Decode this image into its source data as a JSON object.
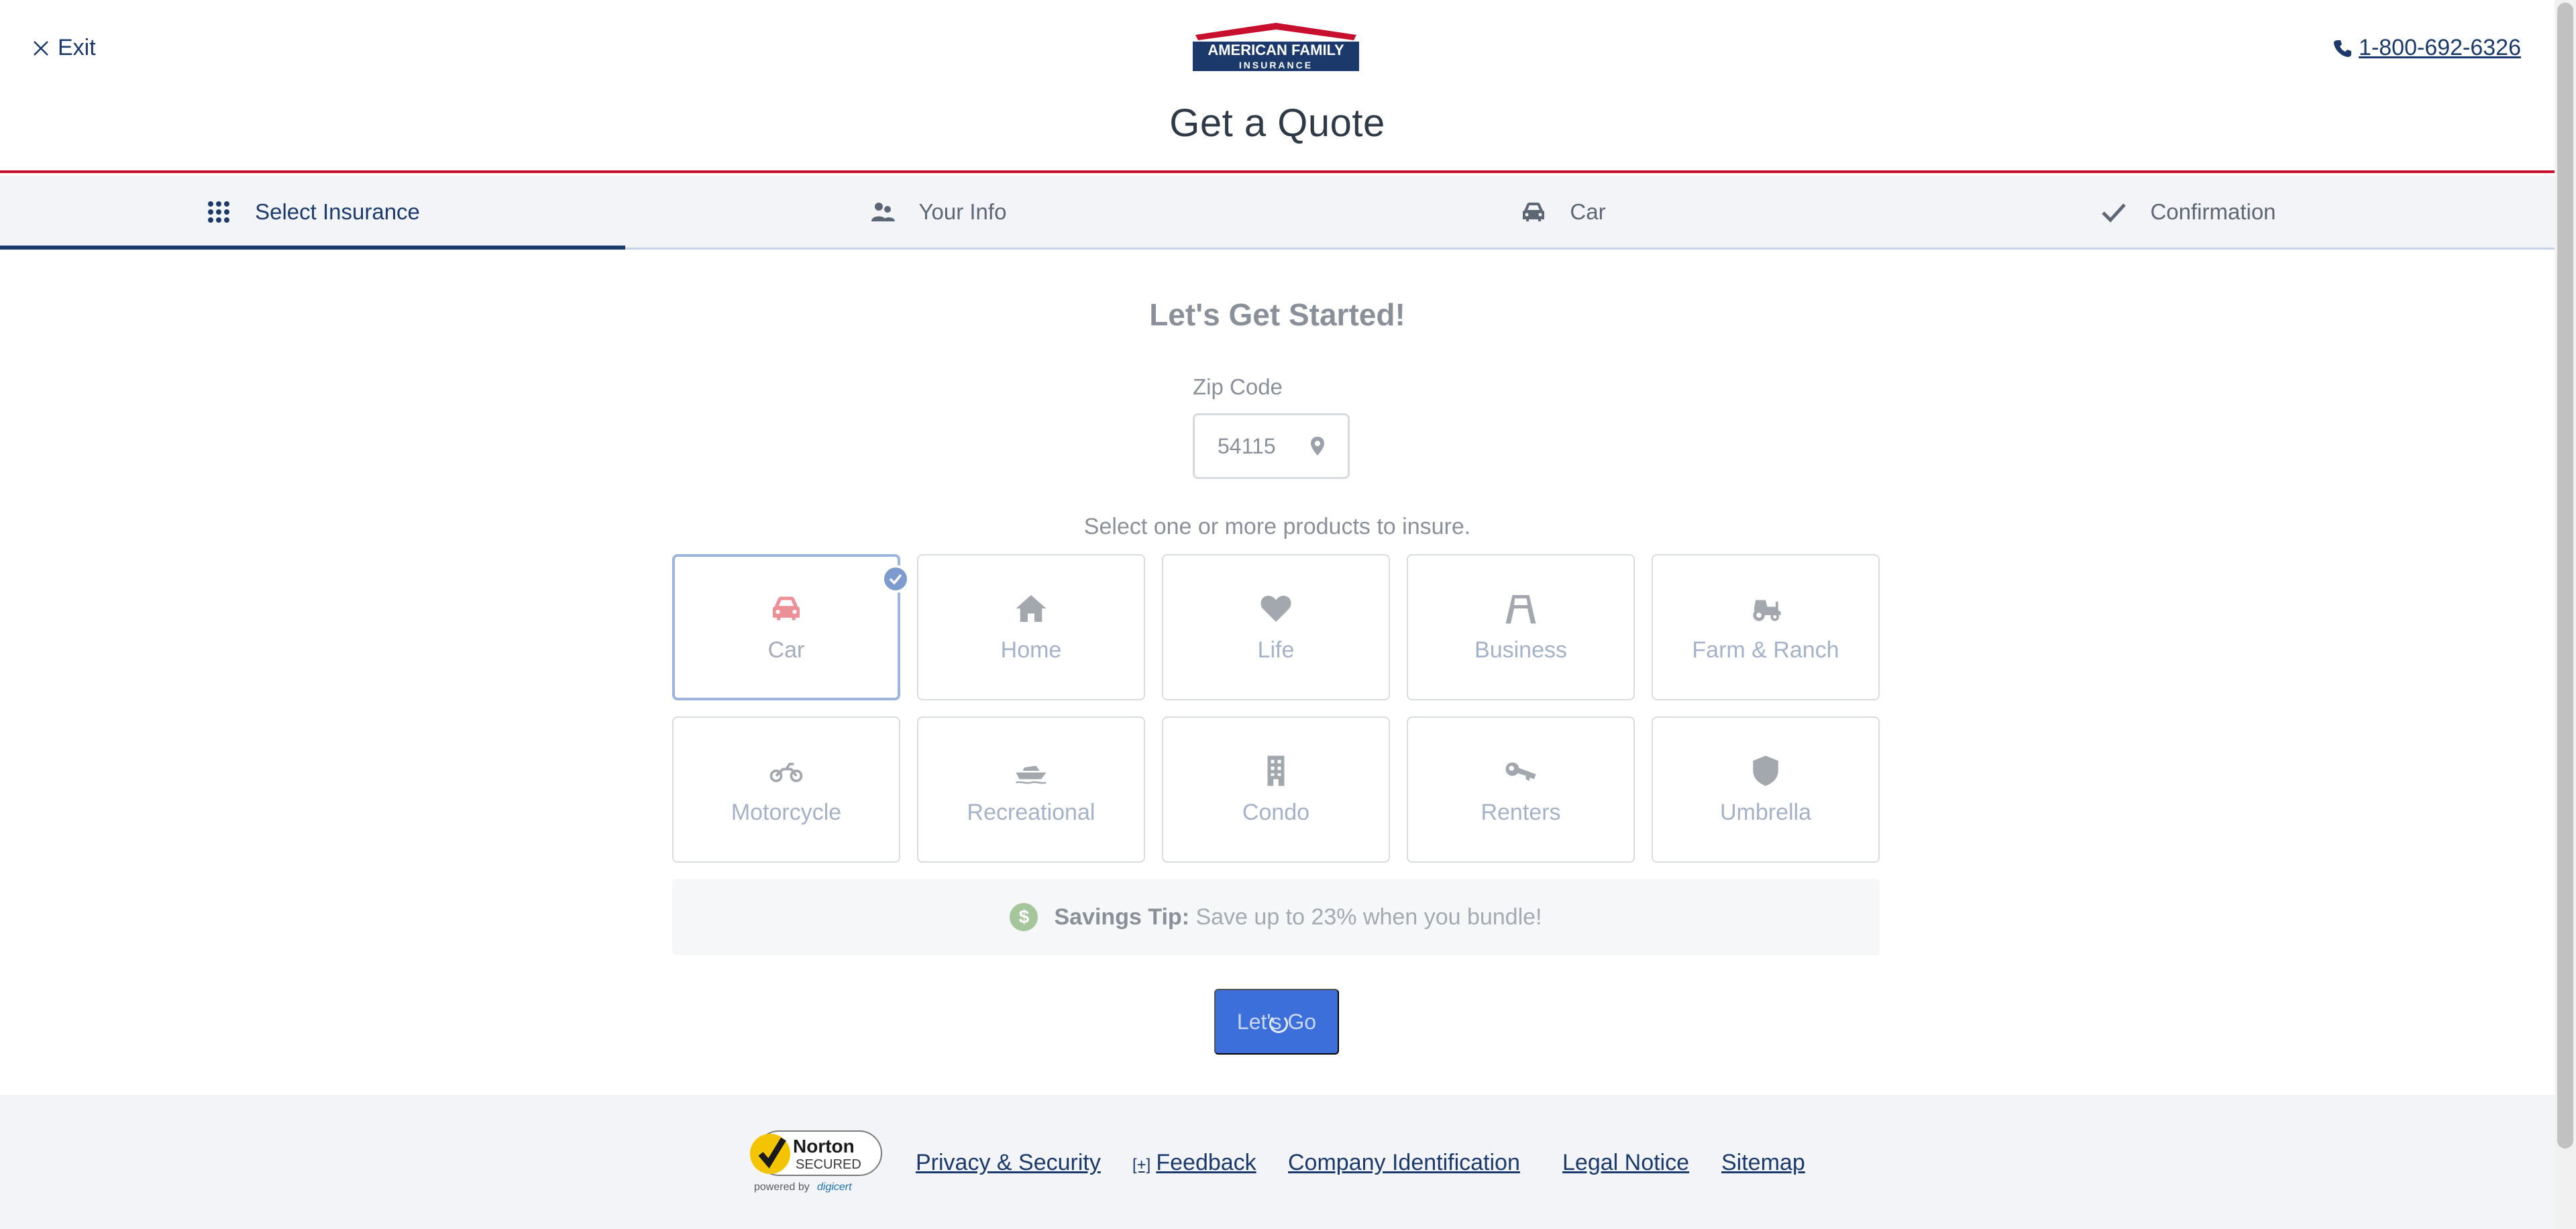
{
  "header": {
    "exit_label": "Exit",
    "logo_line1": "AMERICAN FAMILY",
    "logo_line2": "INSURANCE",
    "phone": "1-800-692-6326",
    "title": "Get a Quote",
    "colors": {
      "brand_red": "#c8102e",
      "brand_blue": "#1b3a6b"
    }
  },
  "steps": [
    {
      "label": "Select Insurance",
      "icon": "grid-dots-icon",
      "active": true
    },
    {
      "label": "Your Info",
      "icon": "people-icon",
      "active": false
    },
    {
      "label": "Car",
      "icon": "car-icon",
      "active": false
    },
    {
      "label": "Confirmation",
      "icon": "check-icon",
      "active": false
    }
  ],
  "main": {
    "heading": "Let's Get Started!",
    "zip_label": "Zip Code",
    "zip_value": "54115",
    "select_prompt": "Select one or more products to insure.",
    "products": [
      {
        "label": "Car",
        "icon": "car-icon",
        "selected": true
      },
      {
        "label": "Home",
        "icon": "home-icon",
        "selected": false
      },
      {
        "label": "Life",
        "icon": "heart-icon",
        "selected": false
      },
      {
        "label": "Business",
        "icon": "business-sign-icon",
        "selected": false
      },
      {
        "label": "Farm & Ranch",
        "icon": "tractor-icon",
        "selected": false
      },
      {
        "label": "Motorcycle",
        "icon": "motorcycle-icon",
        "selected": false
      },
      {
        "label": "Recreational",
        "icon": "boat-icon",
        "selected": false
      },
      {
        "label": "Condo",
        "icon": "building-icon",
        "selected": false
      },
      {
        "label": "Renters",
        "icon": "key-icon",
        "selected": false
      },
      {
        "label": "Umbrella",
        "icon": "shield-icon",
        "selected": false
      }
    ],
    "tip_title": "Savings Tip:",
    "tip_text": " Save up to 23% when you bundle!",
    "tip_icon_text": "$",
    "go_label": "Let's Go"
  },
  "footer": {
    "norton_line1": "Norton",
    "norton_line2": "SECURED",
    "norton_line3": "powered by digicert",
    "links": {
      "privacy": "Privacy & Security",
      "feedback_plus": "[+]",
      "feedback": "Feedback",
      "company": "Company Identification",
      "legal": "Legal Notice",
      "sitemap": "Sitemap"
    }
  }
}
